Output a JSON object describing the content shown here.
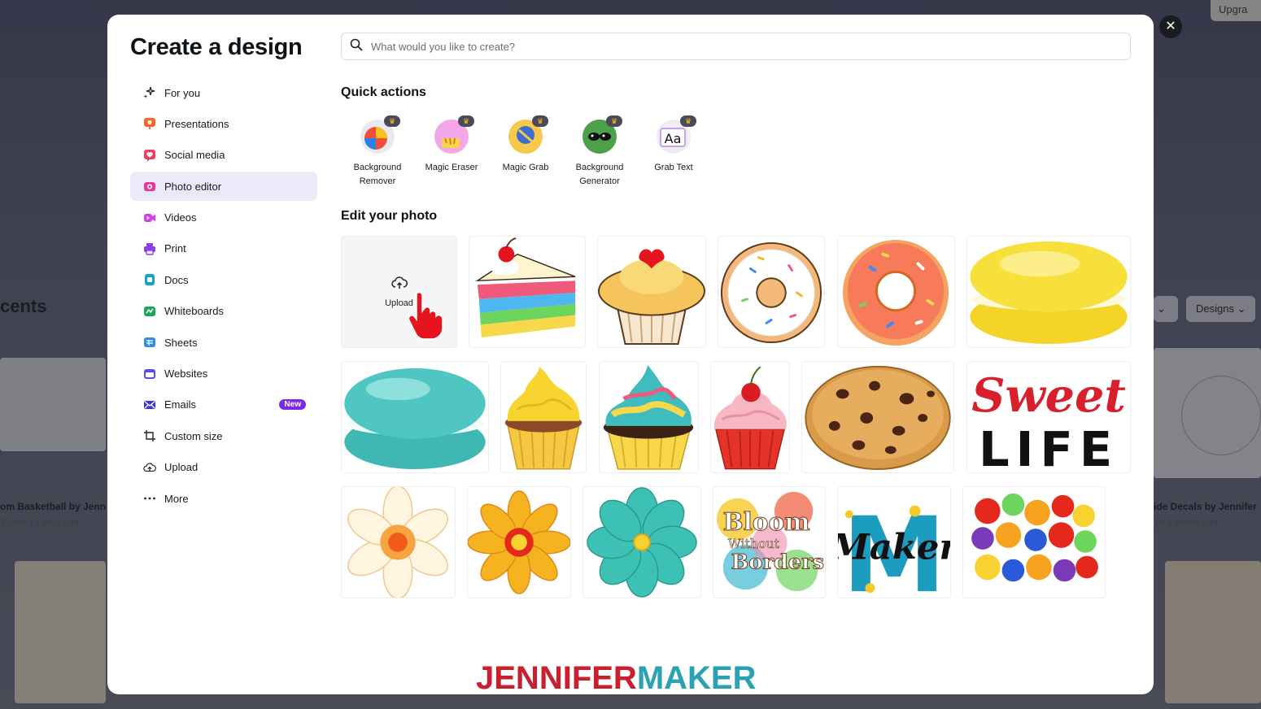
{
  "background": {
    "upgrade_label": "Upgra",
    "recents_label": "cents",
    "card1_title": "om Basketball by Jenn",
    "card1_sub": "Edited 15 days ago",
    "card2_title": "ide Decals by Jennifer",
    "card2_sub": "ed 1 month ago",
    "designs_button": "Designs"
  },
  "modal": {
    "title": "Create a design",
    "close_icon": "close-icon"
  },
  "search": {
    "placeholder": "What would you like to create?",
    "icon": "search-icon"
  },
  "nav": {
    "items": [
      {
        "label": "For you",
        "icon": "sparkle-icon"
      },
      {
        "label": "Presentations",
        "icon": "presentation-icon"
      },
      {
        "label": "Social media",
        "icon": "heart-icon"
      },
      {
        "label": "Photo editor",
        "icon": "camera-icon"
      },
      {
        "label": "Videos",
        "icon": "video-icon"
      },
      {
        "label": "Print",
        "icon": "printer-icon"
      },
      {
        "label": "Docs",
        "icon": "doc-icon"
      },
      {
        "label": "Whiteboards",
        "icon": "whiteboard-icon"
      },
      {
        "label": "Sheets",
        "icon": "sheet-icon"
      },
      {
        "label": "Websites",
        "icon": "website-icon"
      },
      {
        "label": "Emails",
        "icon": "email-icon",
        "badge": "New"
      },
      {
        "label": "Custom size",
        "icon": "crop-icon"
      },
      {
        "label": "Upload",
        "icon": "cloud-upload-icon"
      },
      {
        "label": "More",
        "icon": "more-icon"
      }
    ],
    "active_index": 3
  },
  "quick_actions": {
    "title": "Quick actions",
    "items": [
      {
        "label_line1": "Background",
        "label_line2": "Remover"
      },
      {
        "label_line1": "Magic Eraser",
        "label_line2": ""
      },
      {
        "label_line1": "Magic Grab",
        "label_line2": ""
      },
      {
        "label_line1": "Background",
        "label_line2": "Generator"
      },
      {
        "label_line1": "Grab Text",
        "label_line2": ""
      }
    ]
  },
  "edit_photo": {
    "title": "Edit your photo",
    "upload_label": "Upload",
    "tiles": [
      "cake-slice",
      "cupcake-heart",
      "donut-white",
      "donut-pink",
      "macaron-yellow",
      "macaron-teal",
      "cupcake-yellow",
      "cupcake-rainbow",
      "cupcake-cherry",
      "cookie",
      "sweet-life-text",
      "flower-white",
      "flower-orange",
      "flower-teal",
      "bloom-without-borders",
      "m-maker",
      "fruit-letter"
    ],
    "sweet_line1": "Sweet",
    "sweet_line2": "LIFE",
    "bloom_line1": "Bloom",
    "bloom_line2": "Without",
    "bloom_line3": "Borders",
    "maker_text": "Maker",
    "maker_letter": "M"
  },
  "watermark": {
    "part1": "JENNIFER",
    "part2": "MAKER"
  },
  "colors": {
    "accent": "#7d2ae8",
    "active_bg": "#ece9fb",
    "watermark_red": "#c8202f",
    "watermark_teal": "#2aa2b3"
  }
}
